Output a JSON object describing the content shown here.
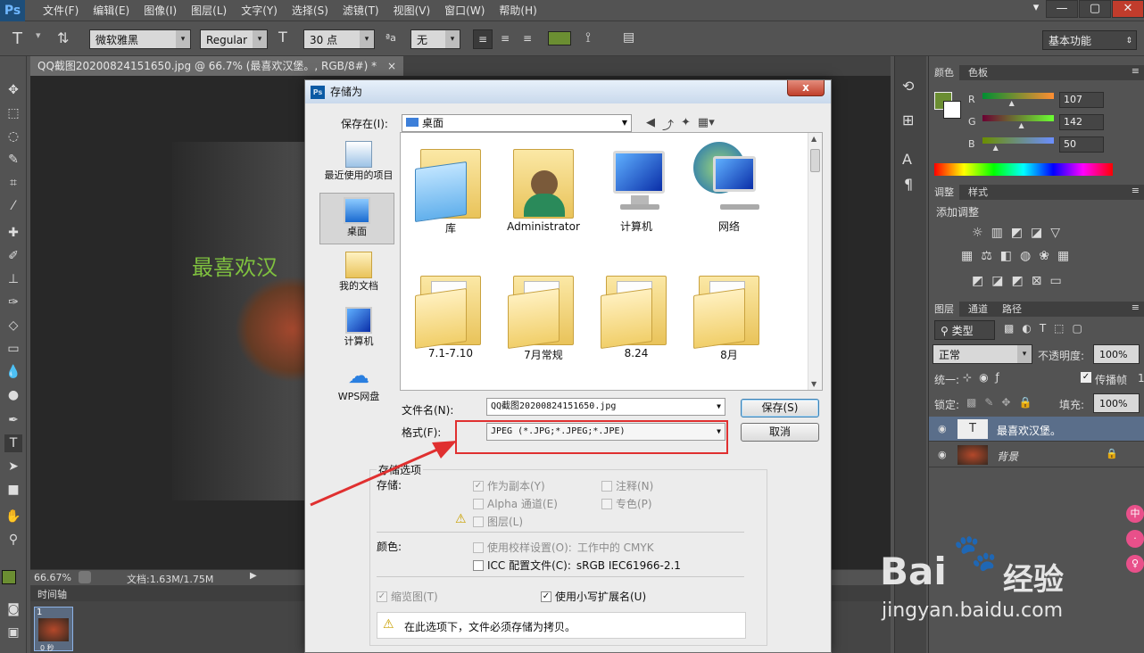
{
  "app": {
    "logo": "Ps"
  },
  "menu": [
    "文件(F)",
    "编辑(E)",
    "图像(I)",
    "图层(L)",
    "文字(Y)",
    "选择(S)",
    "滤镜(T)",
    "视图(V)",
    "窗口(W)",
    "帮助(H)"
  ],
  "window_buttons": [
    "▾",
    "—",
    "▢",
    "✕"
  ],
  "options": {
    "font_family": "微软雅黑",
    "font_style": "Regular",
    "font_size": "30 点",
    "antialias": "无",
    "text_color": "#6b8e32",
    "workspace": "基本功能"
  },
  "document": {
    "tab_title": "QQ截图20200824151650.jpg @ 66.7% (最喜欢汉堡。, RGB/8#) *",
    "canvas_text": "最喜欢汉",
    "zoom": "66.67%",
    "doc_size": "文档:1.63M/1.75M",
    "timeline_label": "时间轴",
    "frame_number": "1",
    "frame_time": "0 秒"
  },
  "color_panel": {
    "tabs": [
      "颜色",
      "色板"
    ],
    "r_label": "R",
    "g_label": "G",
    "b_label": "B",
    "r": "107",
    "g": "142",
    "b": "50",
    "r_level": 0.42,
    "g_level": 0.557,
    "b_level": 0.196,
    "foreground_color": "#6b8e32"
  },
  "adjust_panel": {
    "tabs": [
      "调整",
      "样式"
    ],
    "add_label": "添加调整"
  },
  "layers_panel": {
    "tabs": [
      "图层",
      "通道",
      "路径"
    ],
    "filter": "类型",
    "blend_mode": "正常",
    "opacity_label": "不透明度:",
    "opacity": "100%",
    "unify_label": "统一:",
    "propagate_label": "传播帧",
    "propagate_value": "1",
    "lock_label": "锁定:",
    "fill_label": "填充:",
    "fill": "100%",
    "layers": [
      {
        "name": "最喜欢汉堡。",
        "type": "text"
      },
      {
        "name": "背景",
        "type": "image"
      }
    ]
  },
  "dialog": {
    "title": "存储为",
    "save_in_label": "保存在(I):",
    "save_in_value": "桌面",
    "places": [
      "最近使用的项目",
      "桌面",
      "我的文档",
      "计算机",
      "WPS网盘"
    ],
    "files": [
      "库",
      "Administrator",
      "计算机",
      "网络",
      "7.1-7.10",
      "7月常规",
      "8.24",
      "8月"
    ],
    "filename_label": "文件名(N):",
    "filename_value": "QQ截图20200824151650.jpg",
    "format_label": "格式(F):",
    "format_value": "JPEG (*.JPG;*.JPEG;*.JPE)",
    "save_button": "保存(S)",
    "cancel_button": "取消",
    "options_title": "存储选项",
    "storage_label": "存储:",
    "as_copy": "作为副本(Y)",
    "annotations": "注释(N)",
    "alpha": "Alpha 通道(E)",
    "spot": "专色(P)",
    "layers": "图层(L)",
    "color_label": "颜色:",
    "proof": "使用校样设置(O):",
    "proof_value": "工作中的 CMYK",
    "icc": "ICC 配置文件(C):",
    "icc_value": "sRGB IEC61966-2.1",
    "thumbnail": "缩览图(T)",
    "lowercase_ext": "使用小写扩展名(U)",
    "warning": "在此选项下，文件必须存储为拷贝。"
  },
  "watermark": {
    "brand": "Bai",
    "brand2": "经验",
    "url": "jingyan.baidu.com"
  },
  "side_badges": [
    "中",
    "·",
    "♀"
  ]
}
